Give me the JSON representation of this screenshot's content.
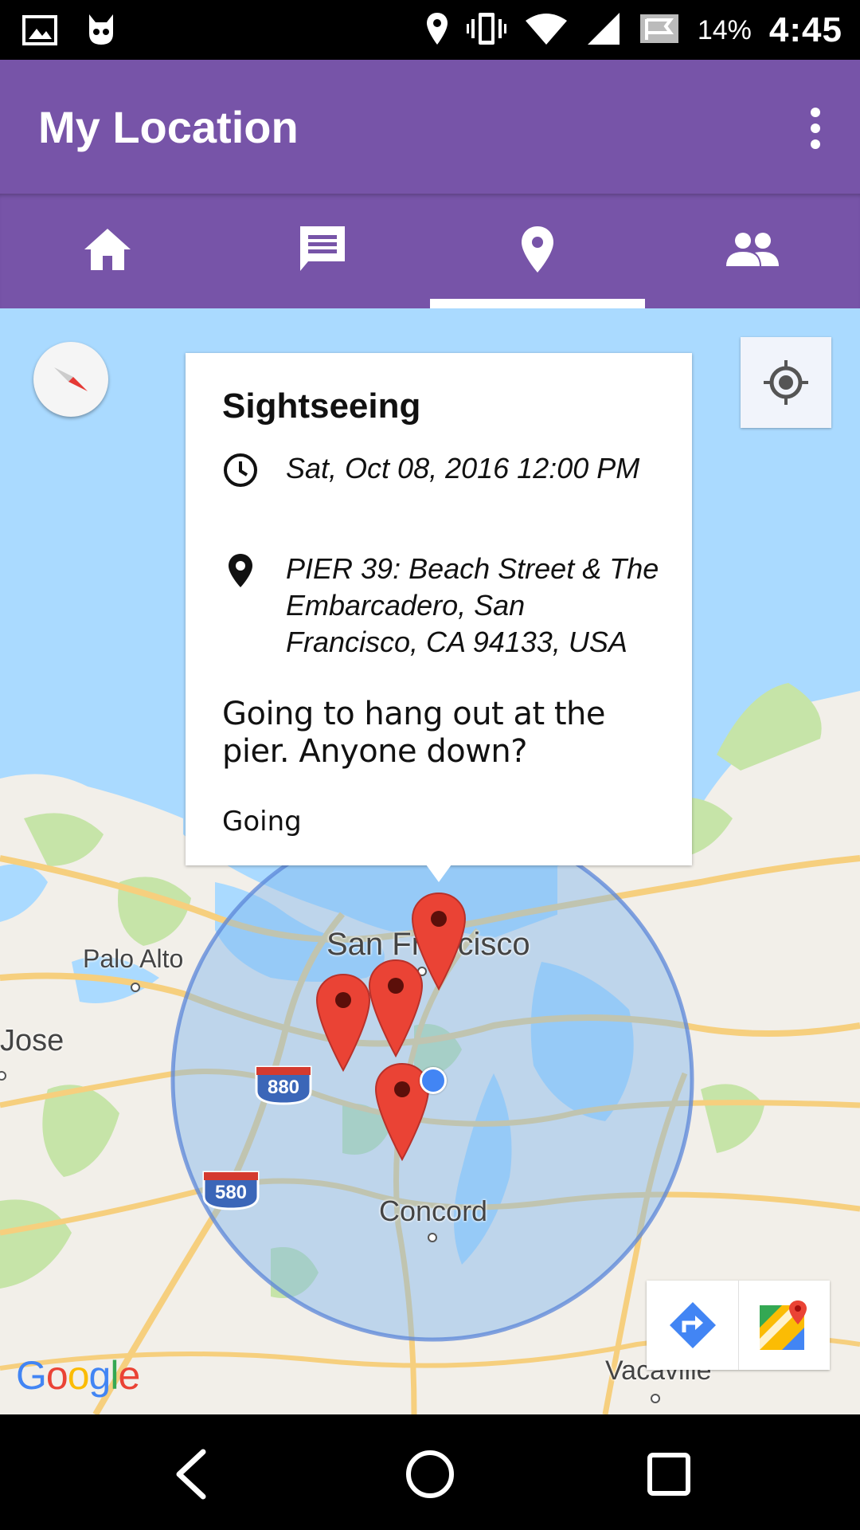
{
  "status_bar": {
    "battery": "14%",
    "time": "4:45",
    "icons": [
      "image-icon",
      "cat-icon",
      "location-icon",
      "vibrate-icon",
      "wifi-icon",
      "signal-icon",
      "flag-icon"
    ]
  },
  "app_bar": {
    "title": "My Location",
    "overflow_icon": "more-vert-icon"
  },
  "tabs": [
    {
      "icon": "home-icon",
      "selected": false
    },
    {
      "icon": "chat-icon",
      "selected": false
    },
    {
      "icon": "location-pin-icon",
      "selected": true
    },
    {
      "icon": "people-icon",
      "selected": false
    }
  ],
  "map": {
    "info_window": {
      "title": "Sightseeing",
      "datetime": "Sat, Oct 08, 2016  12:00 PM",
      "address": "PIER 39:  Beach Street & The Embarcadero, San Francisco, CA 94133, USA",
      "description": "Going to hang out at the pier. Anyone down?",
      "status": "Going"
    },
    "labels": {
      "san_francisco": "San Francisco",
      "palo_alto": "Palo Alto",
      "jose": "Jose",
      "concord": "Concord",
      "vacaville": "Vacaville",
      "hw_880": "880",
      "hw_580": "580"
    },
    "attribution": "Google",
    "colors": {
      "water": "#aadaff",
      "land": "#f2efe9",
      "park": "#c6e4a8",
      "radius_fill": "#7fb6ee",
      "radius_stroke": "#5b86d8",
      "marker": "#ea4335",
      "accent": "#7754a8"
    }
  },
  "nav_bar": {
    "icons": [
      "back-icon",
      "home-circle-icon",
      "recents-icon"
    ]
  }
}
